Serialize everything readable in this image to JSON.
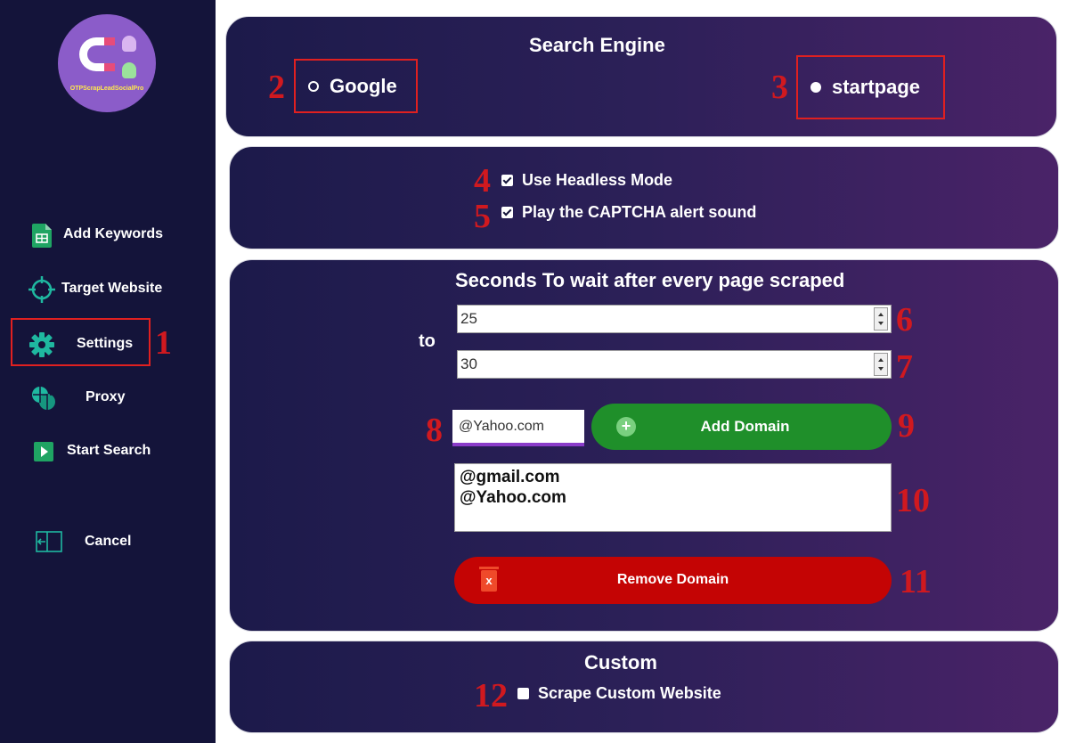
{
  "logo": {
    "text": "OTPScrapLeadSocialPro"
  },
  "sidebar": {
    "items": [
      {
        "label": "Add Keywords",
        "icon": "sheet-icon"
      },
      {
        "label": "Target Website",
        "icon": "crosshair-icon"
      },
      {
        "label": "Settings",
        "icon": "gear-icon"
      },
      {
        "label": "Proxy",
        "icon": "globe-icon"
      },
      {
        "label": "Start Search",
        "icon": "play-icon"
      },
      {
        "label": "Cancel",
        "icon": "exit-icon"
      }
    ],
    "selected": "Settings"
  },
  "search_engine": {
    "title": "Search Engine",
    "options": [
      {
        "label": "Google",
        "selected": false
      },
      {
        "label": "startpage",
        "selected": true
      }
    ]
  },
  "options": {
    "headless": {
      "label": "Use Headless Mode",
      "checked": true
    },
    "captcha_sound": {
      "label": "Play the CAPTCHA alert sound",
      "checked": true
    }
  },
  "wait": {
    "title": "Seconds To wait after every page scraped",
    "to_label": "to",
    "from_value": "25",
    "to_value": "30"
  },
  "domains": {
    "input_value": "@Yahoo.com",
    "add_label": "Add Domain",
    "add_icon": "+",
    "list": [
      "@gmail.com",
      "@Yahoo.com"
    ],
    "remove_label": "Remove Domain",
    "remove_icon": "x"
  },
  "custom": {
    "title": "Custom",
    "scrape_custom": {
      "label": "Scrape Custom Website",
      "checked": false
    }
  },
  "annotations": [
    "1",
    "2",
    "3",
    "4",
    "5",
    "6",
    "7",
    "8",
    "9",
    "10",
    "11",
    "12"
  ],
  "colors": {
    "sidebar_bg": "#14143a",
    "accent_green": "#1f8f2a",
    "accent_red": "#c40404",
    "annotation_red": "#d0191f",
    "icon_teal": "#1fb8a0"
  }
}
